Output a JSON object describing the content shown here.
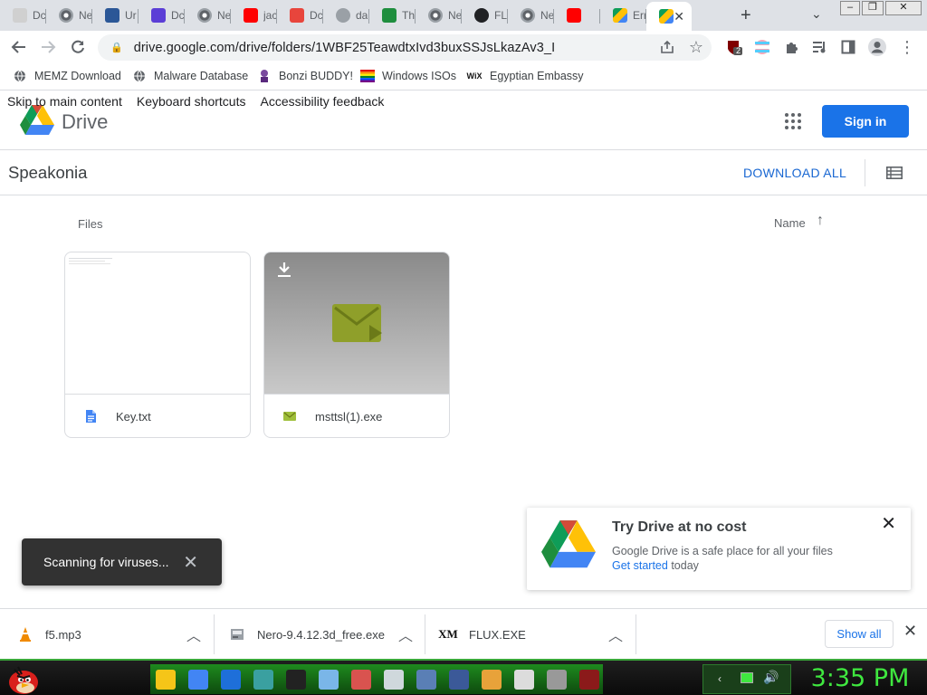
{
  "browser": {
    "tabs": [
      {
        "title": "Dc",
        "icon": "acrobat-icon",
        "active": false
      },
      {
        "title": "Ne",
        "icon": "chrome-icon",
        "active": false
      },
      {
        "title": "Ur",
        "icon": "site-icon",
        "active": false
      },
      {
        "title": "Dc",
        "icon": "shield-icon",
        "active": false
      },
      {
        "title": "Ne",
        "icon": "chrome-icon",
        "active": false
      },
      {
        "title": "jac",
        "icon": "youtube-icon",
        "active": false
      },
      {
        "title": "Dc",
        "icon": "red-icon",
        "active": false
      },
      {
        "title": "da",
        "icon": "globe-icon",
        "active": false
      },
      {
        "title": "Th",
        "icon": "sheet-icon",
        "active": false
      },
      {
        "title": "Ne",
        "icon": "chrome-icon",
        "active": false
      },
      {
        "title": "FL",
        "icon": "cloud-icon",
        "active": false
      },
      {
        "title": "Ne",
        "icon": "chrome-icon",
        "active": false
      },
      {
        "title": "",
        "icon": "youtube-icon",
        "active": false
      },
      {
        "title": "Err",
        "icon": "drive-icon",
        "active": false
      },
      {
        "title": "",
        "icon": "drive-icon",
        "active": true
      }
    ],
    "url": "drive.google.com/drive/folders/1WBF25TeawdtxIvd3buxSSJsLkazAv3_I",
    "extension_badge": "2",
    "bookmarks": [
      {
        "label": "MEMZ Download",
        "icon": "globe-icon"
      },
      {
        "label": "Malware Database",
        "icon": "globe-icon"
      },
      {
        "label": "Bonzi BUDDY!",
        "icon": "bonzi-icon"
      },
      {
        "label": "Windows ISOs",
        "icon": "rainbow-icon"
      },
      {
        "label": "Egyptian Embassy",
        "icon": "wix-icon",
        "icon_text": "WiX"
      }
    ]
  },
  "drive": {
    "skip_links": [
      "Skip to main content",
      "Keyboard shortcuts",
      "Accessibility feedback"
    ],
    "product_name": "Drive",
    "sign_in": "Sign in",
    "folder_name": "Speakonia",
    "download_all": "DOWNLOAD ALL",
    "files_label": "Files",
    "sort_label": "Name",
    "files": [
      {
        "name": "Key.txt",
        "icon": "text-doc-icon"
      },
      {
        "name": "msttsl(1).exe",
        "icon": "exe-icon"
      }
    ],
    "toast": "Scanning for viruses...",
    "promo": {
      "title": "Try Drive at no cost",
      "body": "Google Drive is a safe place for all your files",
      "link": "Get started",
      "suffix": " today"
    }
  },
  "downloads": {
    "items": [
      {
        "name": "f5.mp3",
        "icon": "vlc-cone-icon"
      },
      {
        "name": "Nero-9.4.12.3d_free.exe",
        "icon": "installer-icon"
      },
      {
        "name": "FLUX.EXE",
        "icon": "xm-icon",
        "icon_text": "XM"
      }
    ],
    "show_all": "Show all"
  },
  "taskbar": {
    "clock": "3:35 PM"
  },
  "colors": {
    "accent": "#1a73e8",
    "toast_bg": "#323232",
    "clock": "#3fe83f",
    "taskbar_band": "#1e8a1e"
  }
}
